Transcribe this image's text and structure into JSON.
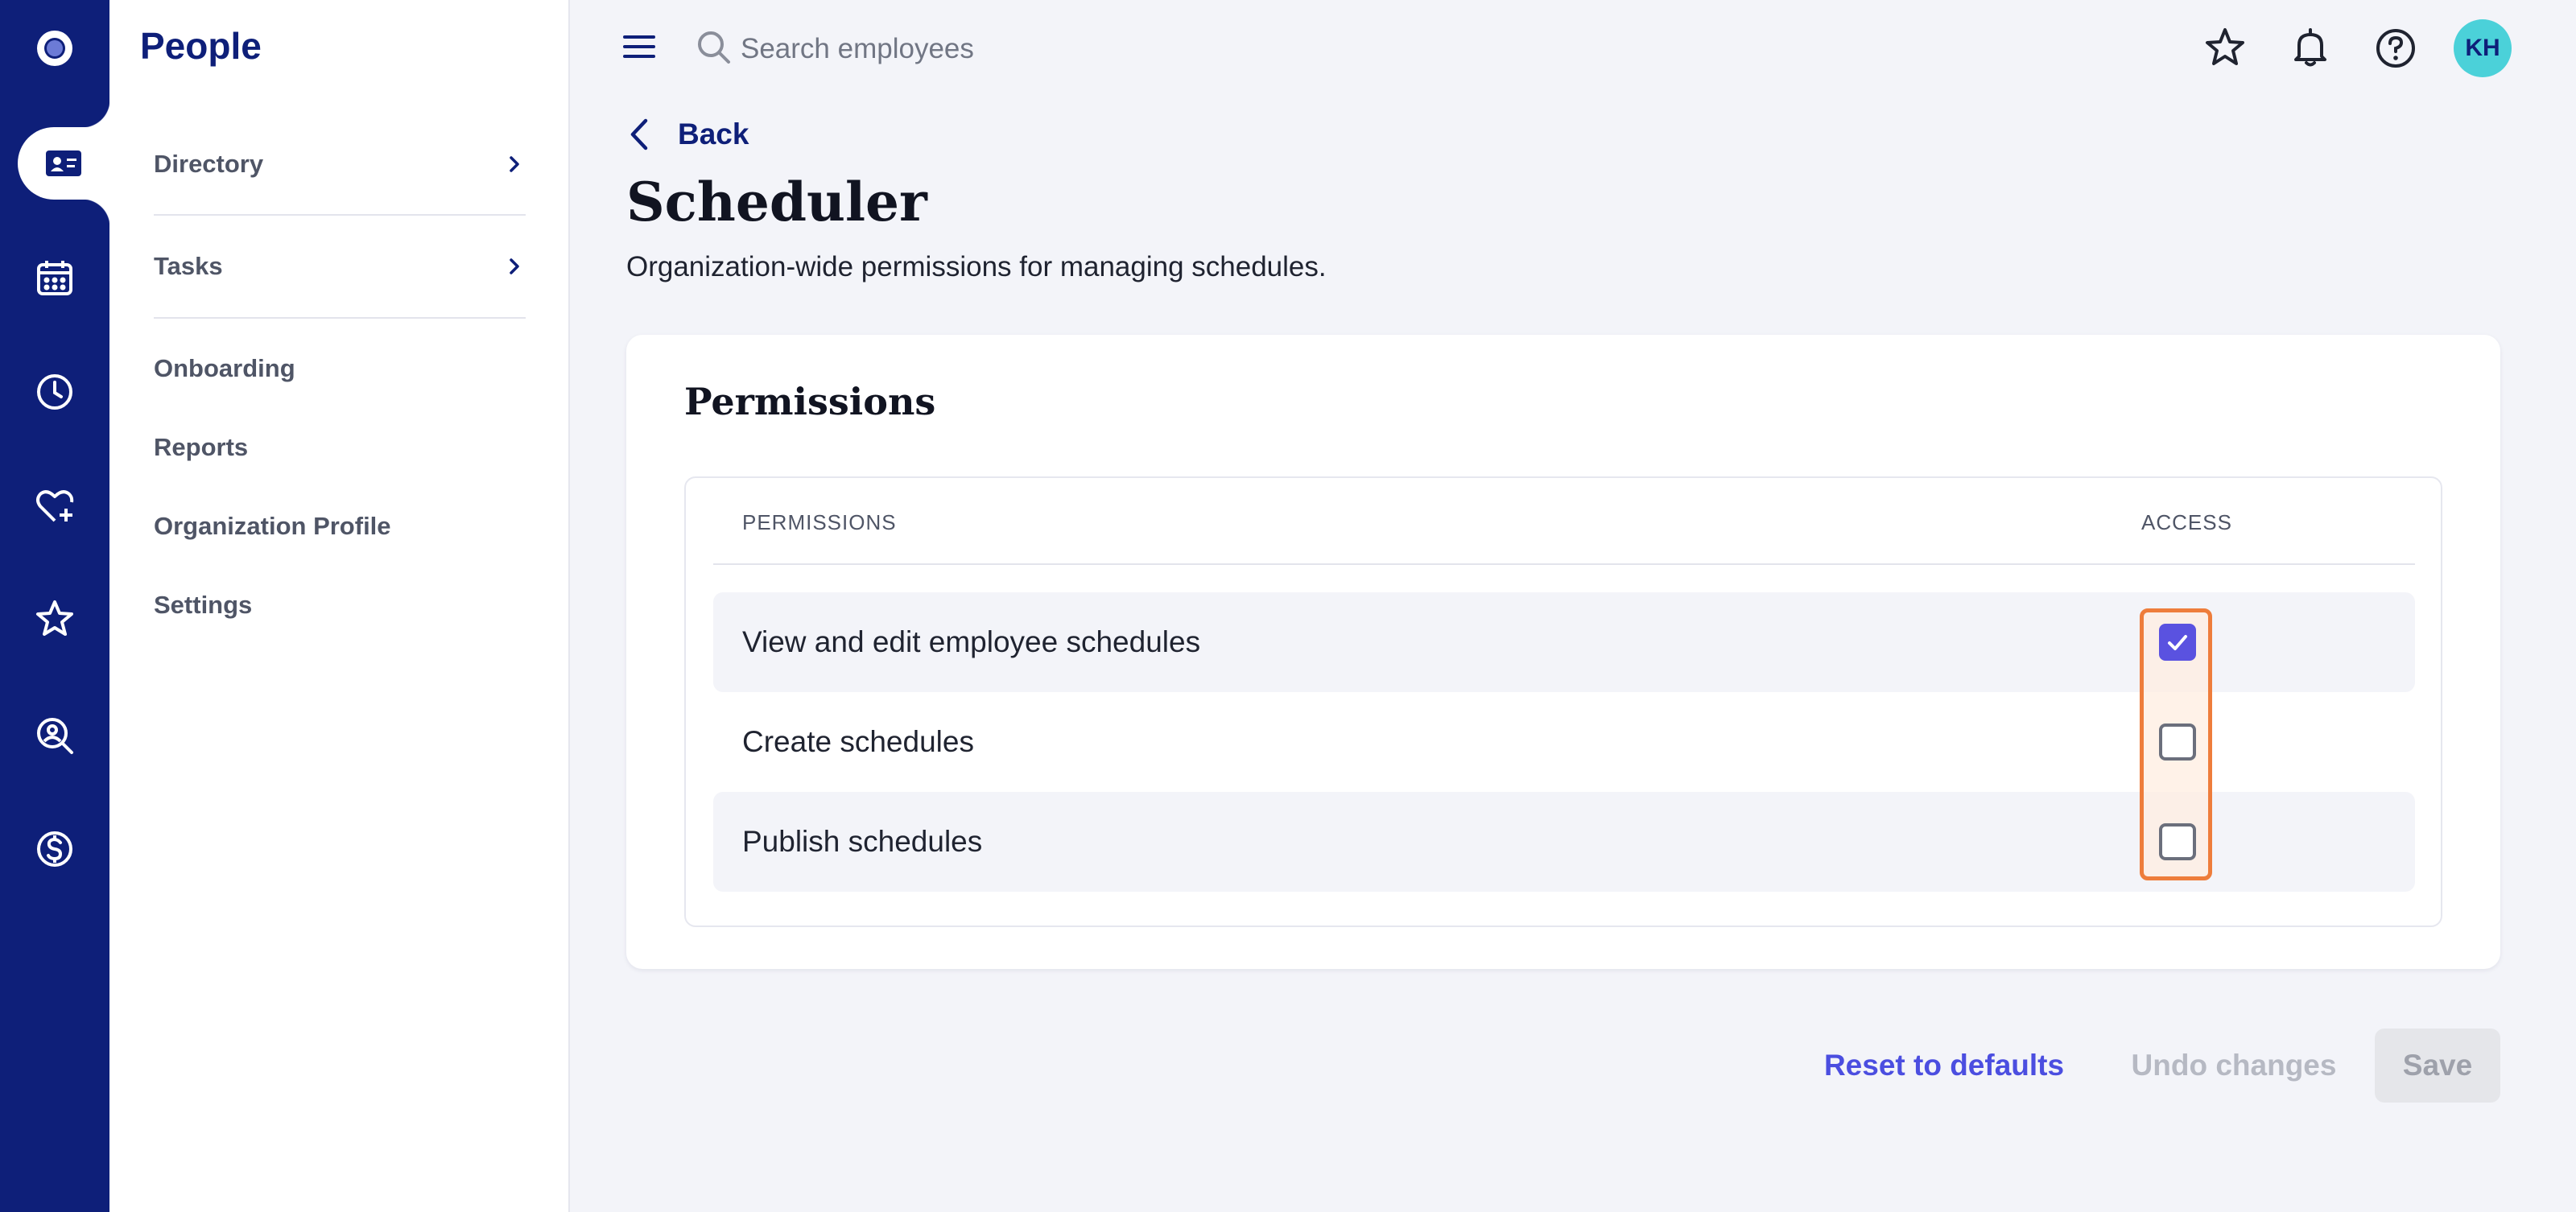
{
  "app": {
    "section_title": "People",
    "rail_icons": [
      "logo-icon",
      "people-card-icon",
      "calendar-icon",
      "clock-icon",
      "heart-plus-icon",
      "star-icon",
      "search-person-icon",
      "dollar-icon"
    ],
    "accent_color": "#0e1f79"
  },
  "sidebar": {
    "items": [
      {
        "label": "Directory",
        "has_submenu": true
      },
      {
        "label": "Tasks",
        "has_submenu": true
      },
      {
        "label": "Onboarding",
        "has_submenu": false
      },
      {
        "label": "Reports",
        "has_submenu": false
      },
      {
        "label": "Organization Profile",
        "has_submenu": false
      },
      {
        "label": "Settings",
        "has_submenu": false
      }
    ]
  },
  "topbar": {
    "search_placeholder": "Search employees",
    "icons": [
      "star-icon",
      "bell-icon",
      "help-icon"
    ],
    "avatar_initials": "KH",
    "avatar_color": "#4bd1d9"
  },
  "page": {
    "back_label": "Back",
    "title": "Scheduler",
    "description": "Organization-wide permissions for managing schedules."
  },
  "permissions_card": {
    "title": "Permissions",
    "columns": [
      "PERMISSIONS",
      "ACCESS"
    ],
    "rows": [
      {
        "label": "View and edit employee schedules",
        "access": true
      },
      {
        "label": "Create schedules",
        "access": false
      },
      {
        "label": "Publish schedules",
        "access": false
      }
    ],
    "checkbox_color": "#5a52e0",
    "highlight_color": "#ee7d3b"
  },
  "actions": {
    "reset_label": "Reset to defaults",
    "undo_label": "Undo changes",
    "save_label": "Save"
  }
}
